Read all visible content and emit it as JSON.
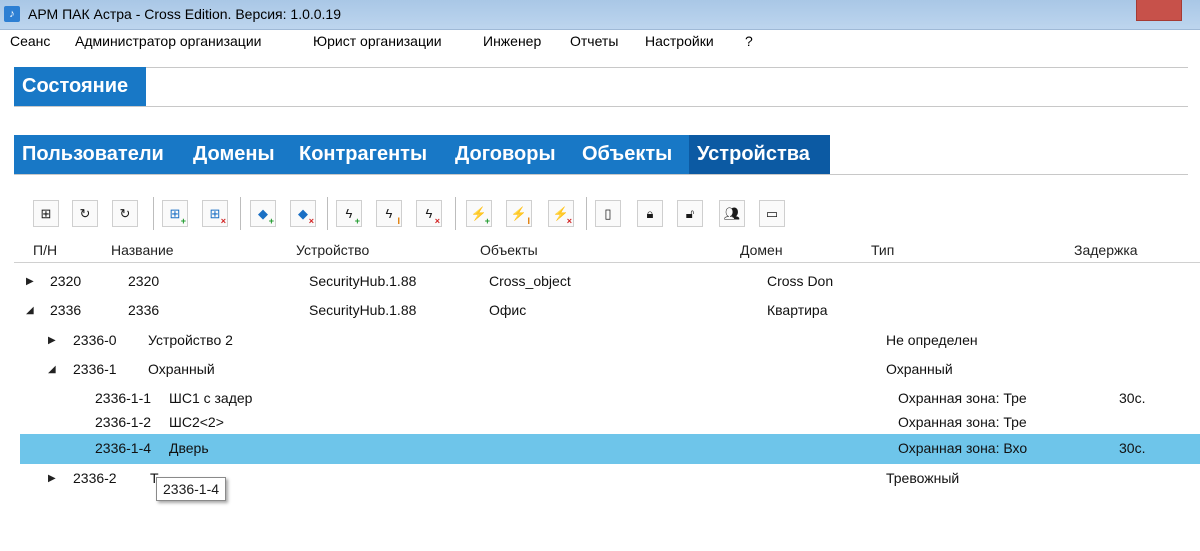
{
  "window": {
    "title": "АРМ ПАК Астра - Cross Edition. Версия: 1.0.0.19"
  },
  "menu": [
    "Сеанс",
    "Администратор организации",
    "Юрист организации",
    "Инженер",
    "Отчеты",
    "Настройки",
    "?"
  ],
  "state_tab": "Состояние",
  "tabs": [
    "Пользователи",
    "Домены",
    "Контрагенты",
    "Договоры",
    "Объекты",
    "Устройства"
  ],
  "active_tab": "Устройства",
  "columns": [
    "П/Н",
    "Название",
    "Устройство",
    "Объекты",
    "Домен",
    "Тип",
    "Задержка"
  ],
  "rows": [
    {
      "sn": "2320",
      "name": "2320",
      "device": "SecurityHub.1.88",
      "objects": "Cross_object",
      "domain": "Cross Don",
      "type": "",
      "delay": ""
    },
    {
      "sn": "2336",
      "name": "2336",
      "device": "SecurityHub.1.88",
      "objects": "Офис",
      "domain": "Квартира",
      "type": "",
      "delay": ""
    },
    {
      "sn": "2336-0",
      "name": "Устройство 2",
      "device": "",
      "objects": "",
      "domain": "",
      "type": "Не определен",
      "delay": ""
    },
    {
      "sn": "2336-1",
      "name": "Охранный",
      "device": "",
      "objects": "",
      "domain": "",
      "type": "Охранный",
      "delay": ""
    },
    {
      "sn": "2336-1-1",
      "name": "ШС1 с задер",
      "device": "",
      "objects": "",
      "domain": "",
      "type": "Охранная зона: Тре",
      "delay": "30с."
    },
    {
      "sn": "2336-1-2",
      "name": "ШС2<2>",
      "device": "",
      "objects": "",
      "domain": "",
      "type": "Охранная зона: Тре",
      "delay": ""
    },
    {
      "sn": "2336-1-4",
      "name": "Дверь",
      "device": "",
      "objects": "",
      "domain": "",
      "type": "Охранная зона: Вхо",
      "delay": "30с."
    },
    {
      "sn": "2336-2",
      "name": "Т",
      "device": "",
      "objects": "",
      "domain": "",
      "type": "Тревожный",
      "delay": ""
    }
  ],
  "tooltip": "2336-1-4",
  "toolbar": [
    "hierarchy-icon",
    "refresh-icon",
    "refresh-clock-icon",
    "add-node-icon",
    "remove-node-icon",
    "add-device-icon",
    "remove-device-icon",
    "add-zone-icon",
    "edit-zone-icon",
    "remove-zone-icon",
    "add-script-icon",
    "edit-script-icon",
    "remove-script-icon",
    "phone-icon",
    "lock-icon",
    "unlock-icon",
    "users-icon",
    "window-icon"
  ]
}
